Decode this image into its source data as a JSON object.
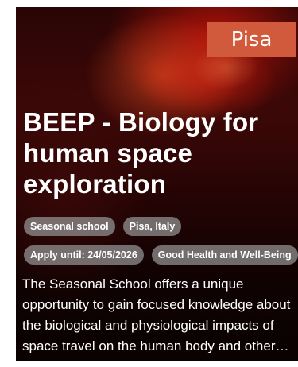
{
  "card": {
    "city": "Pisa",
    "title": "BEEP - Biology for human space exploration",
    "tags_row1": [
      "Seasonal school",
      "Pisa, Italy"
    ],
    "tags_row2": [
      "Apply until: 24/05/2026",
      "Good Health and Well-Being"
    ],
    "description": "The Seasonal School offers a unique opportunity to gain focused knowledge about the biological and physiological impacts of space travel on the human body and other organisms.",
    "colors": {
      "badge": "#d25a3c",
      "chip": "#969696",
      "text": "#ffffff"
    }
  }
}
